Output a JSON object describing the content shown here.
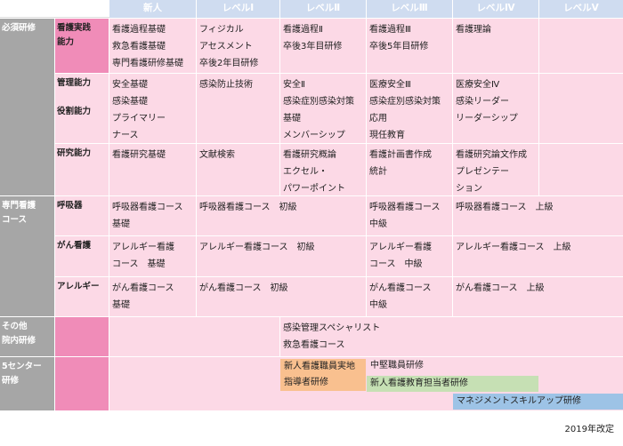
{
  "headers": [
    "新人",
    "レベルⅠ",
    "レベルⅡ",
    "レベルⅢ",
    "レベルⅣ",
    "レベルⅤ"
  ],
  "categories": {
    "required": "必須研修",
    "specialist": "専門看護\nコース",
    "other": "その他\n院内研修",
    "center": "5センター\n研修"
  },
  "subcategories": {
    "practice": "看護実践\n能力",
    "mgmt": "管理能力\n\n役割能力",
    "research": "研究能力",
    "resp": "呼吸器",
    "cancer": "がん看護",
    "allergy": "アレルギー"
  },
  "cells": {
    "practice_new": "看護過程基礎\n救急看護基礎\n専門看護研修基礎",
    "practice_l1": "フィジカル\nアセスメント\n卒後2年目研修",
    "practice_l2": "看護過程Ⅱ\n卒後3年目研修",
    "practice_l3": "看護過程Ⅲ\n卒後5年目研修",
    "practice_l4": "看護理論",
    "mgmt_new": "安全基礎\n感染基礎\nプライマリー\nナース",
    "mgmt_l1": "感染防止技術",
    "mgmt_l2": "安全Ⅱ\n感染症別感染対策\n基礎\nメンバーシップ",
    "mgmt_l3": "医療安全Ⅲ\n感染症別感染対策\n応用\n現任教育",
    "mgmt_l4": "医療安全Ⅳ\n感染リーダー\nリーダーシップ",
    "research_new": "看護研究基礎",
    "research_l1": "文献検索",
    "research_l2": "看護研究概論\nエクセル・\nパワーポイント",
    "research_l3": "看護計画書作成\n統計",
    "research_l4": "看護研究論文作成\nプレゼンテー\nション",
    "resp_new": "呼吸器看護コース\n基礎",
    "resp_l1": "呼吸器看護コース　初級",
    "resp_l3": "呼吸器看護コース\n中級",
    "resp_l4": "呼吸器看護コース　上級",
    "cancer_new": "アレルギー看護\nコース　基礎",
    "cancer_l1": "アレルギー看護コース　初級",
    "cancer_l3": "アレルギー看護\nコース　中級",
    "cancer_l4": "アレルギー看護コース　上級",
    "allergy_new": "がん看護コース\n基礎",
    "allergy_l1": "がん看護コース　初級",
    "allergy_l3": "がん看護コース\n中級",
    "allergy_l4": "がん看護コース　上級",
    "other_l2": "感染管理スペシャリスト\n救急看護コース"
  },
  "center_bars": {
    "orange": "新人看護職員実地\n指導者研修",
    "mid": "中堅職員研修",
    "green": "新人看護教育担当者研修",
    "blue": "マネジメントスキルアップ研修"
  },
  "colors": {
    "header": "#cfdcf0",
    "category": "#a6a6a6",
    "subcategory": "#f08cb8",
    "cell": "#fcd9e6",
    "orange_bar": "#f9c08f",
    "green_bar": "#c6e0b4",
    "blue_bar": "#9dc3e6"
  },
  "footer": "2019年改定"
}
